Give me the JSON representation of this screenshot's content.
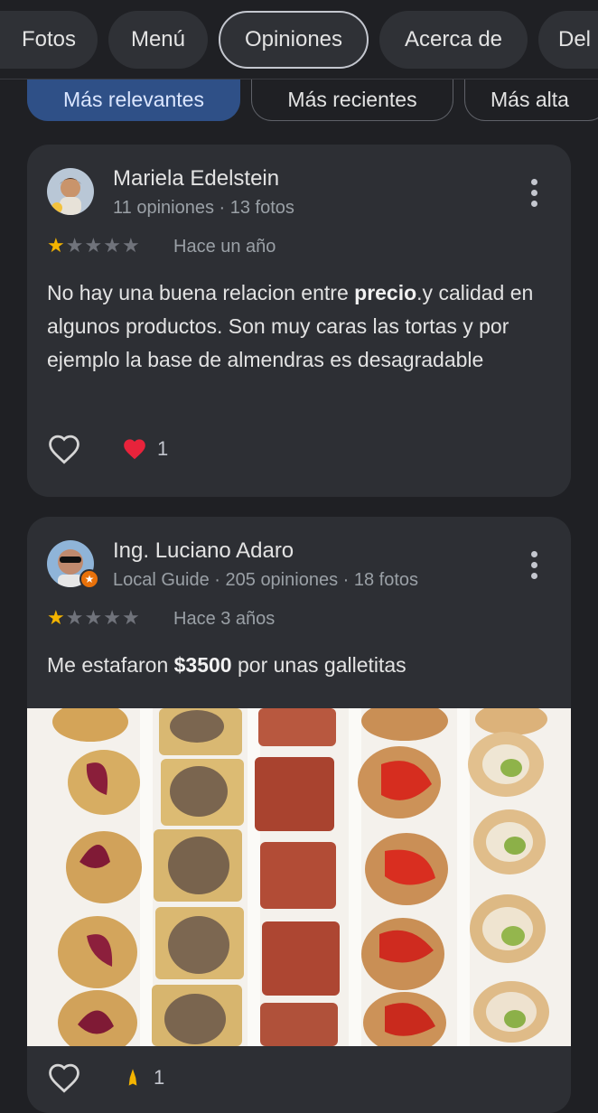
{
  "tabs": [
    {
      "label": "Fotos"
    },
    {
      "label": "Menú"
    },
    {
      "label": "Opiniones",
      "active": true
    },
    {
      "label": "Acerca de"
    },
    {
      "label": "Del"
    }
  ],
  "sort_chips": [
    {
      "label": "Más relevantes",
      "active": true
    },
    {
      "label": "Más recientes"
    },
    {
      "label": "Más alta"
    }
  ],
  "reviews": [
    {
      "name": "Mariela Edelstein",
      "meta": "11 opiniones · 13 fotos",
      "rating": 1,
      "date": "Hace un año",
      "text_parts": [
        "No hay una buena relacion entre ",
        "precio",
        ".y calidad en algunos productos. Son muy caras las tortas y por ejemplo la base de almendras es desagradable"
      ],
      "reaction_count": "1"
    },
    {
      "name": "Ing. Luciano Adaro",
      "meta": "Local Guide · 205 opiniones · 18 fotos",
      "rating": 1,
      "date": "Hace 3 años",
      "text_parts": [
        "Me estafaron ",
        "$3500",
        " por unas galletitas"
      ],
      "reaction_count": "1"
    }
  ],
  "colors": {
    "background": "#1f2024",
    "card": "#2d2f34",
    "accent_chip": "#2f5087",
    "star": "#f4b400",
    "heart": "#e8233b"
  }
}
